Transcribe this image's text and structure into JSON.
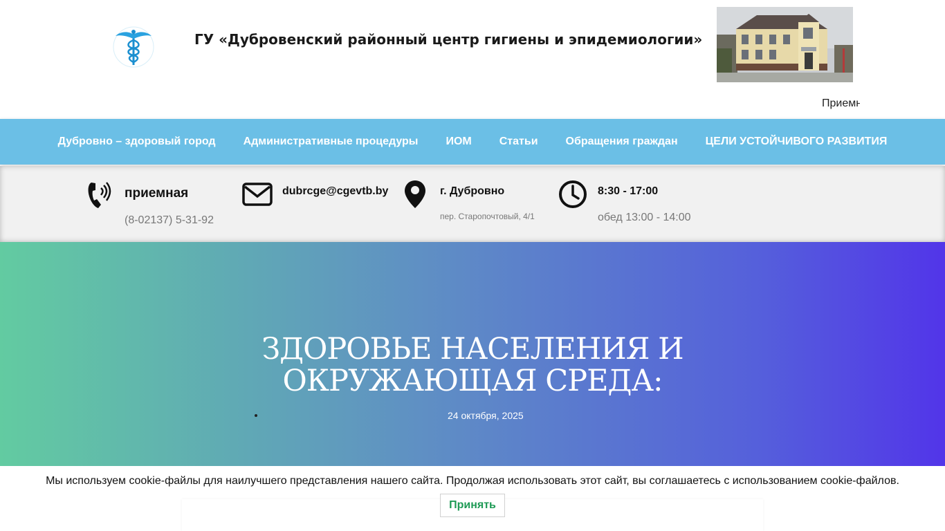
{
  "header": {
    "title": "ГУ «Дубровенский районный центр гигиены и эпидемиологии»",
    "ticker": "Приемн"
  },
  "nav": {
    "items": [
      {
        "label": "Дубровно – здоровый город"
      },
      {
        "label": "Административные процедуры"
      },
      {
        "label": "ИОМ"
      },
      {
        "label": "Статьи"
      },
      {
        "label": "Обращения граждан"
      },
      {
        "label": "ЦЕЛИ УСТОЙЧИВОГО РАЗВИТИЯ"
      }
    ]
  },
  "contacts": {
    "phone": {
      "title": "приемная",
      "value": "(8-02137) 5-31-92",
      "icon": "phone-icon"
    },
    "email": {
      "value": "dubrcge@cgevtb.by",
      "icon": "envelope-icon"
    },
    "address": {
      "title": "г. Дубровно",
      "value": "пер. Старопочтовый, 4/1",
      "icon": "location-pin-icon"
    },
    "hours": {
      "title": "8:30 - 17:00",
      "value": "обед 13:00 - 14:00",
      "icon": "clock-icon"
    }
  },
  "hero": {
    "title_line1": "ЗДОРОВЬЕ НАСЕЛЕНИЯ И",
    "title_line2": "ОКРУЖАЮЩАЯ СРЕДА:",
    "date": "24 октября, 2025"
  },
  "cookie": {
    "text": "Мы используем cookie-файлы для наилучшего представления нашего сайта. Продолжая использовать этот сайт, вы соглашаетесь с использованием cookie-файлов.",
    "accept_label": "Принять"
  },
  "colors": {
    "nav_bg": "#6bbfe6",
    "hero_gradient_start": "#62cba1",
    "hero_gradient_end": "#5235e9",
    "accept_text": "#1e9a55"
  }
}
